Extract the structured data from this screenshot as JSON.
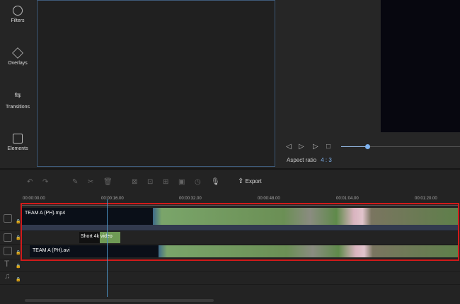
{
  "sidebar": {
    "items": [
      {
        "label": "Filters",
        "icon": "filters-icon"
      },
      {
        "label": "Overlays",
        "icon": "overlays-icon"
      },
      {
        "label": "Transitions",
        "icon": "transitions-icon"
      },
      {
        "label": "Elements",
        "icon": "elements-icon"
      }
    ]
  },
  "player": {
    "aspect_label": "Aspect ratio",
    "aspect_value": "4 : 3",
    "progress_fraction": 0.22
  },
  "toolbar": {
    "export_label": "Export"
  },
  "ruler": {
    "ticks": [
      "00:00:00.00",
      "00:00:16.00",
      "00:00:32.00",
      "00:00:48.00",
      "00:01:04.00",
      "00:01:20.00"
    ]
  },
  "tracks": {
    "clip1": "TEAM A (PH).mp4",
    "clip2": "Short 4k video",
    "clip3": "TEAM A (PH).avi"
  },
  "colors": {
    "accent": "#7eb2ef",
    "highlight": "#d21a1a"
  }
}
